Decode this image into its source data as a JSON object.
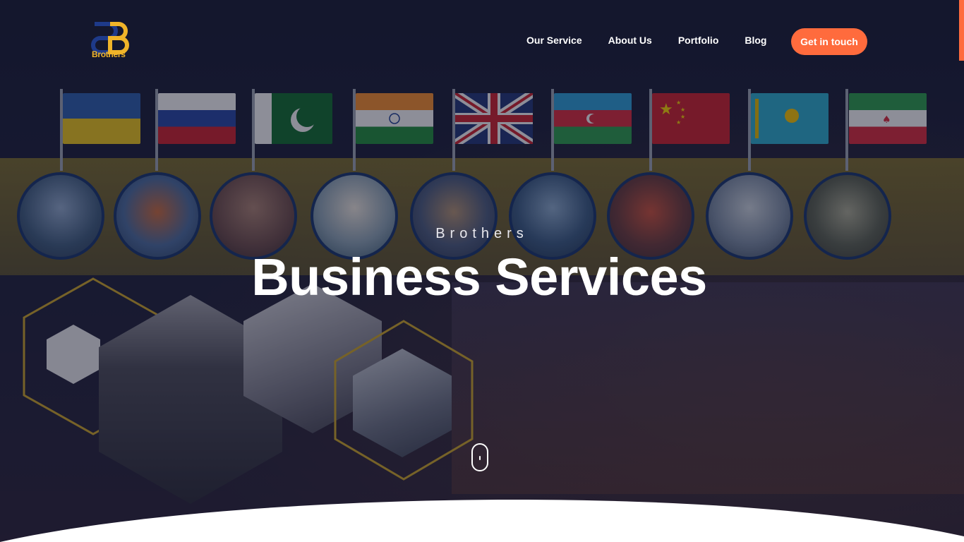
{
  "brand": {
    "logo_text": "Brothers",
    "logo_color": "#f0b429",
    "logo_mark_color": "#1e3a8a"
  },
  "nav": {
    "items": [
      {
        "label": "Our Service"
      },
      {
        "label": "About Us"
      },
      {
        "label": "Portfolio"
      },
      {
        "label": "Blog"
      }
    ],
    "cta_label": "Get in touch",
    "cta_color": "#ff6b3d"
  },
  "hero": {
    "subtitle": "Brothers",
    "title": "Business Services",
    "flags": [
      "ukraine-flag",
      "russia-flag",
      "pakistan-flag",
      "india-flag",
      "united-kingdom-flag",
      "azerbaijan-flag",
      "china-flag",
      "kazakhstan-flag",
      "iran-flag"
    ],
    "city_icons": [
      "kyiv-image",
      "moscow-image",
      "islamabad-image",
      "taj-mahal-image",
      "london-image",
      "baku-image",
      "beijing-image",
      "astana-image",
      "tehran-image"
    ],
    "scroll_indicator": "mouse-scroll-icon"
  },
  "colors": {
    "accent": "#ff6b3d",
    "hex_outline": "#c9a227",
    "band": "#b8a22e",
    "circle_border": "#17346a"
  }
}
